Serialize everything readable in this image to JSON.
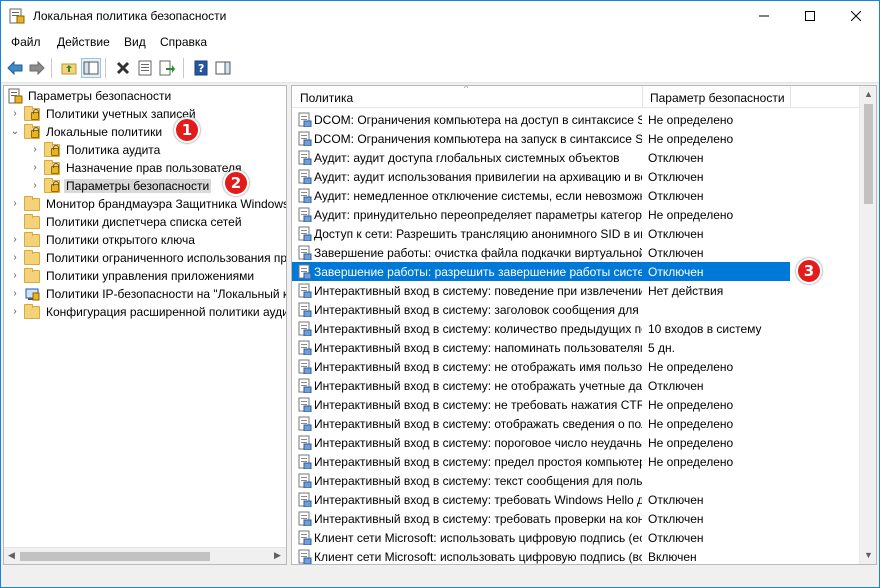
{
  "window": {
    "title": "Локальная политика безопасности"
  },
  "menu": [
    "Файл",
    "Действие",
    "Вид",
    "Справка"
  ],
  "tree": {
    "root": "Параметры безопасности",
    "items": [
      {
        "label": "Политики учетных записей",
        "level": 1,
        "expander": "›",
        "icon": "folder-lock"
      },
      {
        "label": "Локальные политики",
        "level": 1,
        "expander": "⌄",
        "icon": "folder-lock"
      },
      {
        "label": "Политика аудита",
        "level": 2,
        "expander": "›",
        "icon": "folder-lock"
      },
      {
        "label": "Назначение прав пользователя",
        "level": 2,
        "expander": "›",
        "icon": "folder-lock"
      },
      {
        "label": "Параметры безопасности",
        "level": 2,
        "expander": "›",
        "icon": "folder-lock",
        "selected": true
      },
      {
        "label": "Монитор брандмауэра Защитника Windows",
        "level": 1,
        "expander": "›",
        "icon": "folder"
      },
      {
        "label": "Политики диспетчера списка сетей",
        "level": 1,
        "expander": "",
        "icon": "folder"
      },
      {
        "label": "Политики открытого ключа",
        "level": 1,
        "expander": "›",
        "icon": "folder"
      },
      {
        "label": "Политики ограниченного использования программ",
        "level": 1,
        "expander": "›",
        "icon": "folder"
      },
      {
        "label": "Политики управления приложениями",
        "level": 1,
        "expander": "›",
        "icon": "folder"
      },
      {
        "label": "Политики IP-безопасности на \"Локальный компьютер\"",
        "level": 1,
        "expander": "›",
        "icon": "ipsec"
      },
      {
        "label": "Конфигурация расширенной политики аудита",
        "level": 1,
        "expander": "›",
        "icon": "folder"
      }
    ]
  },
  "list": {
    "columns": [
      "Политика",
      "Параметр безопасности"
    ],
    "rows": [
      {
        "policy": "DCOM: Ограничения компьютера на доступ в синтаксисе SDDL",
        "value": "Не определено"
      },
      {
        "policy": "DCOM: Ограничения компьютера на запуск в синтаксисе SDDL",
        "value": "Не определено"
      },
      {
        "policy": "Аудит: аудит доступа глобальных системных объектов",
        "value": "Отключен"
      },
      {
        "policy": "Аудит: аудит использования привилегии на архивацию и восстановление",
        "value": "Отключен"
      },
      {
        "policy": "Аудит: немедленное отключение системы, если невозможно внести в журнал",
        "value": "Отключен"
      },
      {
        "policy": "Аудит: принудительно переопределяет параметры категорий политики аудита",
        "value": "Не определено"
      },
      {
        "policy": "Доступ к сети: Разрешить трансляцию анонимного SID в имя",
        "value": "Отключен"
      },
      {
        "policy": "Завершение работы: очистка файла подкачки виртуальной памяти",
        "value": "Отключен"
      },
      {
        "policy": "Завершение работы: разрешить завершение работы системы без выполнения входа",
        "value": "Отключен",
        "selected": true
      },
      {
        "policy": "Интерактивный вход в систему:  поведение при извлечении смарт-карты",
        "value": "Нет действия"
      },
      {
        "policy": "Интерактивный вход в систему: заголовок сообщения для пользователей",
        "value": ""
      },
      {
        "policy": "Интерактивный вход в систему: количество предыдущих подключений к кэшу",
        "value": "10 входов в систему"
      },
      {
        "policy": "Интерактивный вход в систему: напоминать пользователям об истечении срока",
        "value": "5 дн."
      },
      {
        "policy": "Интерактивный вход в систему: не отображать имя пользователя",
        "value": "Не определено"
      },
      {
        "policy": "Интерактивный вход в систему: не отображать учетные данные последнего",
        "value": "Отключен"
      },
      {
        "policy": "Интерактивный вход в систему: не требовать нажатия CTRL+ALT+DEL",
        "value": "Не определено"
      },
      {
        "policy": "Интерактивный вход в систему: отображать сведения о пользователе",
        "value": "Не определено"
      },
      {
        "policy": "Интерактивный вход в систему: пороговое число неудачных попыток входа",
        "value": "Не определено"
      },
      {
        "policy": "Интерактивный вход в систему: предел простоя компьютера",
        "value": "Не определено"
      },
      {
        "policy": "Интерактивный вход в систему: текст сообщения для пользователей",
        "value": ""
      },
      {
        "policy": "Интерактивный вход в систему: требовать Windows Hello для бизнеса",
        "value": "Отключен"
      },
      {
        "policy": "Интерактивный вход в систему: требовать проверки на контроллере домена",
        "value": "Отключен"
      },
      {
        "policy": "Клиент сети Microsoft: использовать цифровую подпись (если сервер согласен)",
        "value": "Отключен"
      },
      {
        "policy": "Клиент сети Microsoft: использовать цифровую подпись (всегда)",
        "value": "Включен"
      }
    ]
  },
  "callouts": [
    "1",
    "2",
    "3"
  ],
  "colors": {
    "selection": "#0078d7",
    "callout": "#e41b1b",
    "title_border": "#1883d7"
  }
}
